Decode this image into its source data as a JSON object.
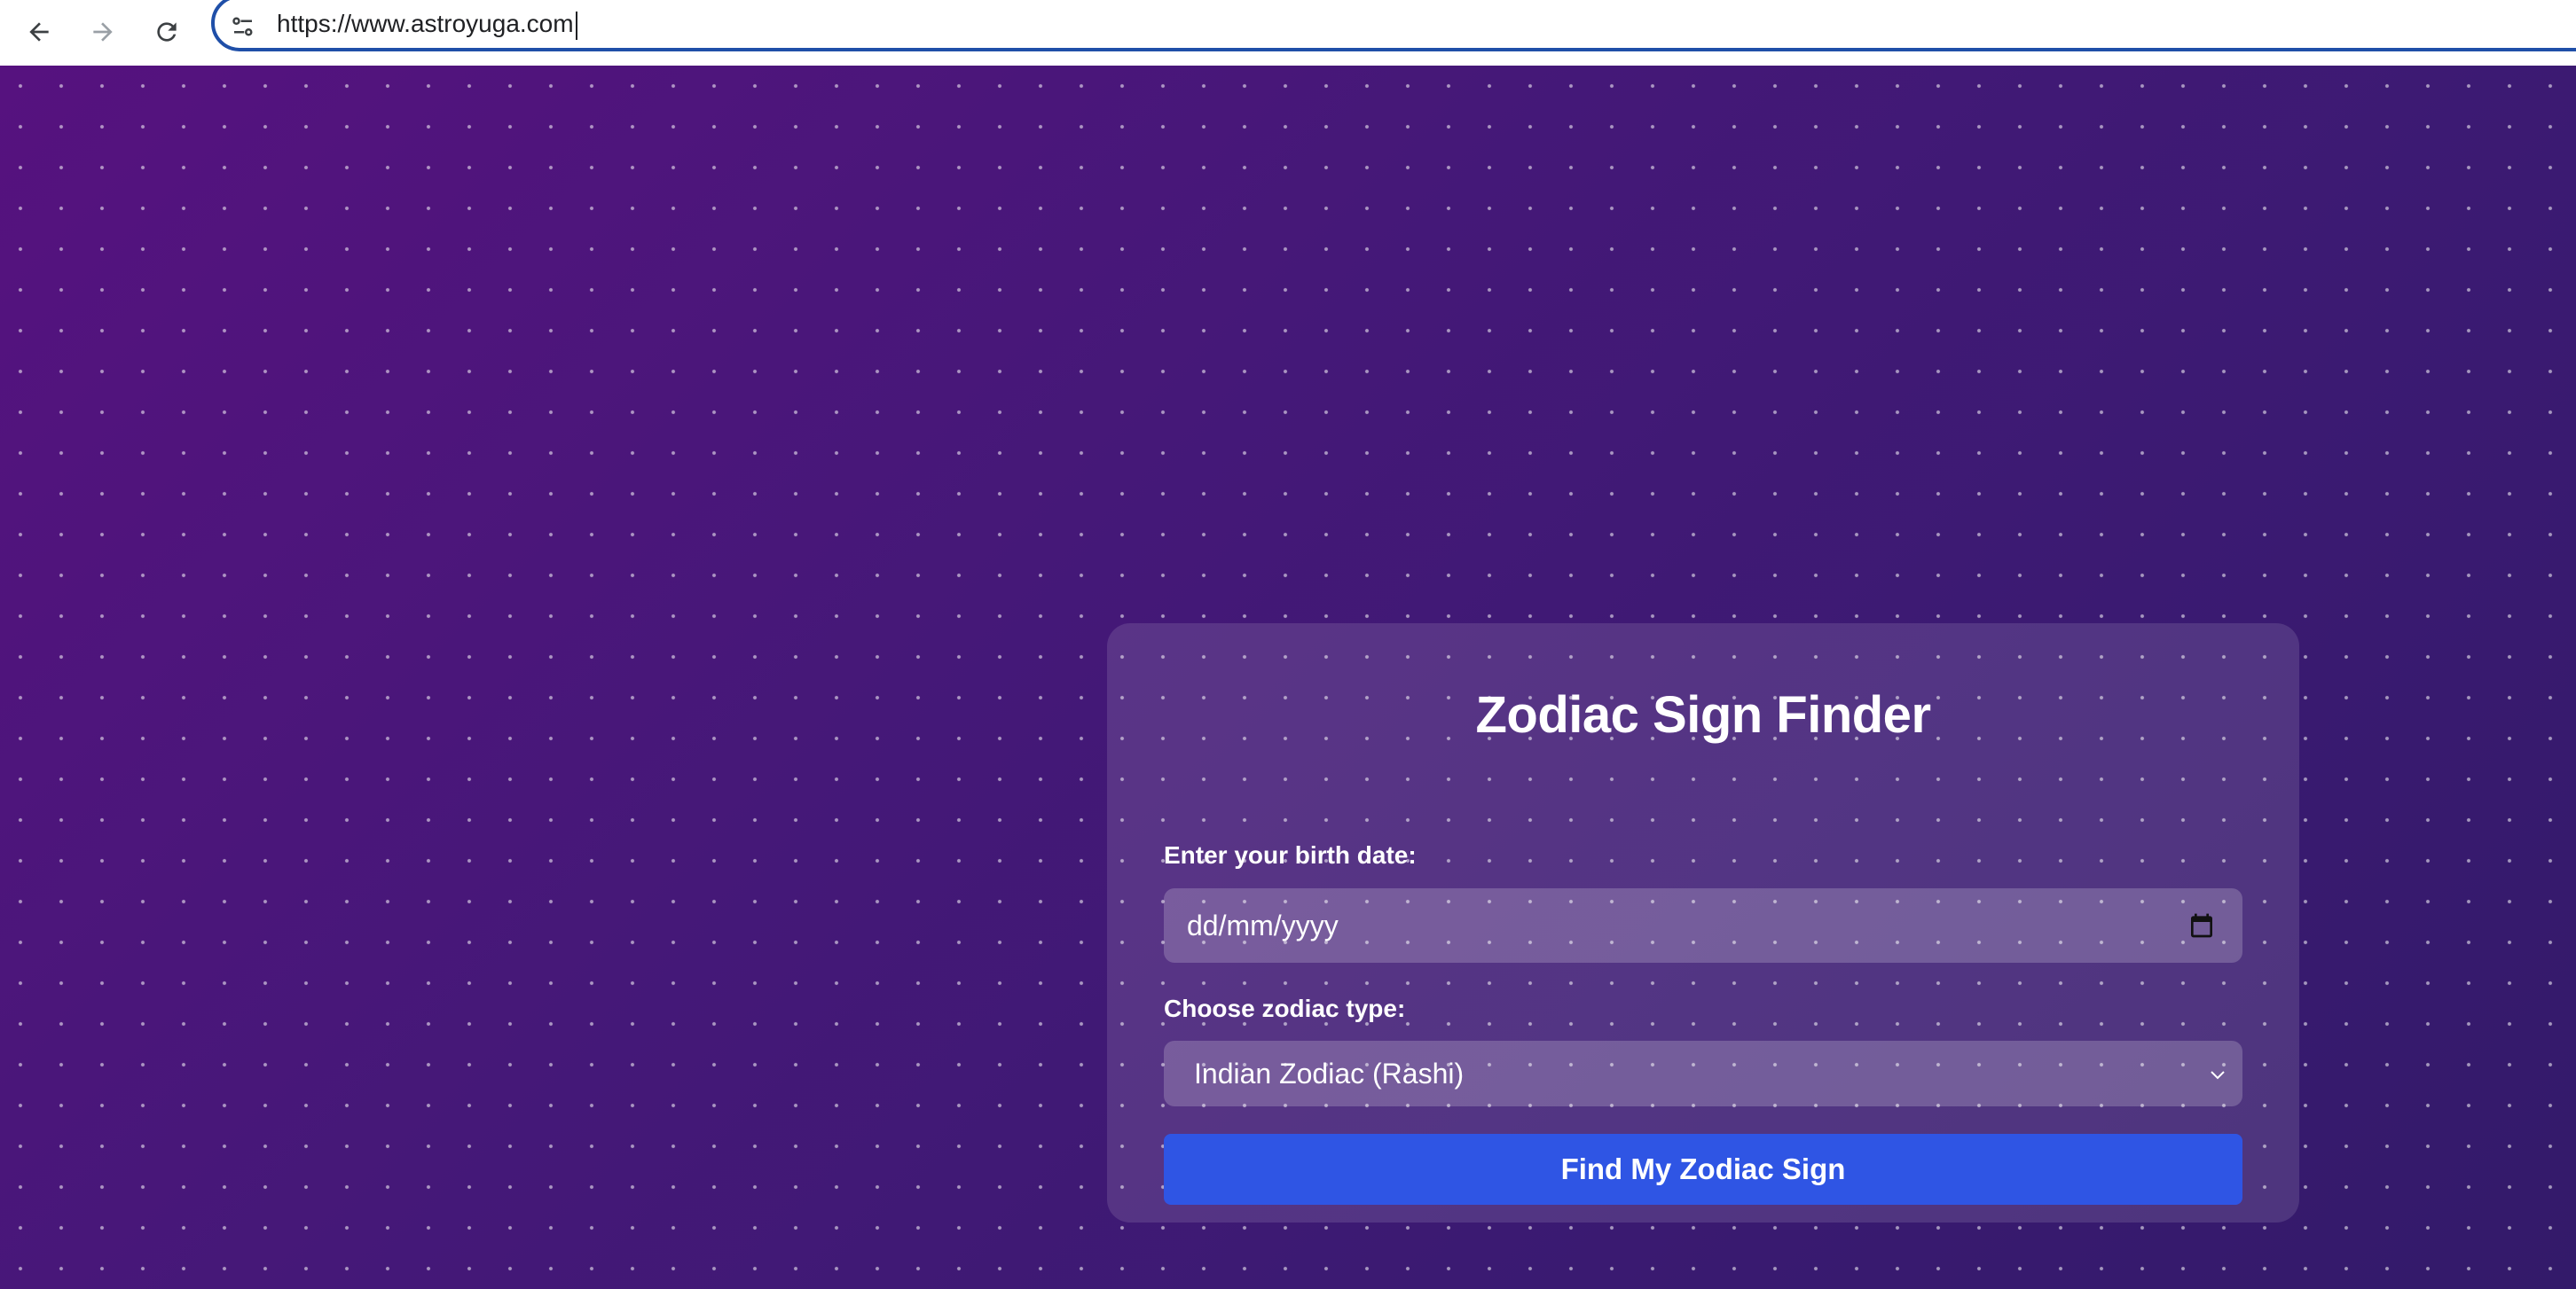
{
  "browser": {
    "url": "https://www.astroyuga.com",
    "icons": {
      "back": "arrow-left-icon",
      "forward": "arrow-right-icon",
      "reload": "reload-icon",
      "site_info": "tune-icon"
    }
  },
  "form": {
    "title": "Zodiac Sign Finder",
    "birth_date_label": "Enter your birth date:",
    "birth_date_placeholder": "dd/mm/yyyy",
    "zodiac_type_label": "Choose zodiac type:",
    "zodiac_type_selected": "Indian Zodiac (Rashi)",
    "submit_label": "Find My Zodiac Sign"
  },
  "colors": {
    "background_start": "#56127f",
    "background_end": "#331a6a",
    "button": "#2f55e4",
    "omnibox_border": "#1f4fa8"
  }
}
